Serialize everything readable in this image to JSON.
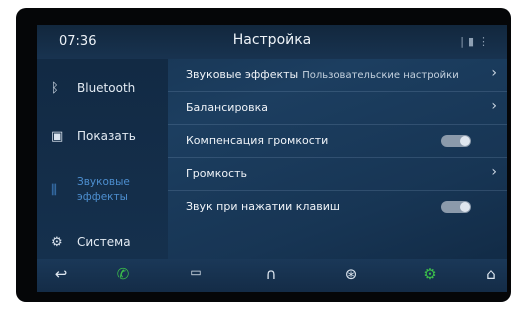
{
  "status": {
    "time": "07:36",
    "title": "Настройка"
  },
  "sidebar": {
    "items": [
      {
        "label": "Bluetooth",
        "icon": "bluetooth-icon"
      },
      {
        "label": "Показать",
        "icon": "display-icon"
      },
      {
        "label": "Звуковые эффекты",
        "icon": "equalizer-icon",
        "active": true
      },
      {
        "label": "Система",
        "icon": "gear-icon"
      }
    ]
  },
  "settings": {
    "sound_effects": {
      "label": "Звуковые эффекты",
      "value": "Пользовательские настройки"
    },
    "balance": {
      "label": "Балансировка"
    },
    "loudness": {
      "label": "Компенсация громкости",
      "toggle": "off"
    },
    "volume": {
      "label": "Громкость"
    },
    "key_beep": {
      "label": "Звук при нажатии клавиш",
      "toggle": "off"
    }
  },
  "dock": {
    "items": [
      "back-icon",
      "phone-icon",
      "radio-icon",
      "headphones-icon",
      "steering-wheel-icon",
      "settings-icon",
      "home-icon"
    ]
  },
  "colors": {
    "accent": "#3f7fc2",
    "green": "#3bbf4a"
  }
}
